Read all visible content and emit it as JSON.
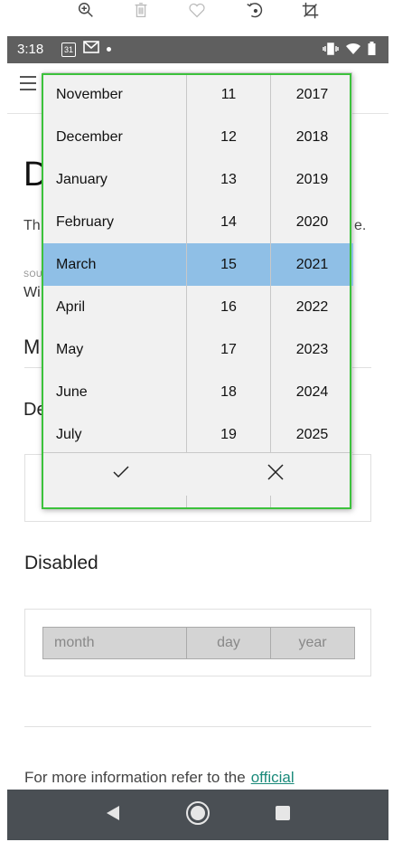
{
  "status": {
    "time": "3:18",
    "calendar_day": "31"
  },
  "page": {
    "title": "D",
    "intro_start": "Th",
    "intro_end": "e.",
    "source_label": "SOU",
    "source_value": "Wi",
    "section_m": "M",
    "section_de": "De",
    "section_disabled": "Disabled",
    "disabled_picker": {
      "month": "month",
      "day": "day",
      "year": "year"
    },
    "more_info": "For more information refer to the",
    "more_info_link": "official"
  },
  "picker": {
    "months": [
      "November",
      "December",
      "January",
      "February",
      "March",
      "April",
      "May",
      "June",
      "July"
    ],
    "days": [
      "11",
      "12",
      "13",
      "14",
      "15",
      "16",
      "17",
      "18",
      "19"
    ],
    "years": [
      "2017",
      "2018",
      "2019",
      "2020",
      "2021",
      "2022",
      "2023",
      "2024",
      "2025"
    ],
    "selected_index": 4,
    "selected": {
      "month": "March",
      "day": "15",
      "year": "2021"
    }
  },
  "colors": {
    "selection": "#8fbfe6",
    "highlight": "#3cc23c",
    "status_bar": "#5f5f5f",
    "nav_bar": "#4a4f54",
    "link": "#1a8a7a"
  },
  "icons": {
    "toolbar": [
      "zoom-in-icon",
      "trash-icon",
      "heart-icon",
      "rotate-icon",
      "crop-icon"
    ],
    "confirm": "check-icon",
    "cancel": "close-icon"
  }
}
